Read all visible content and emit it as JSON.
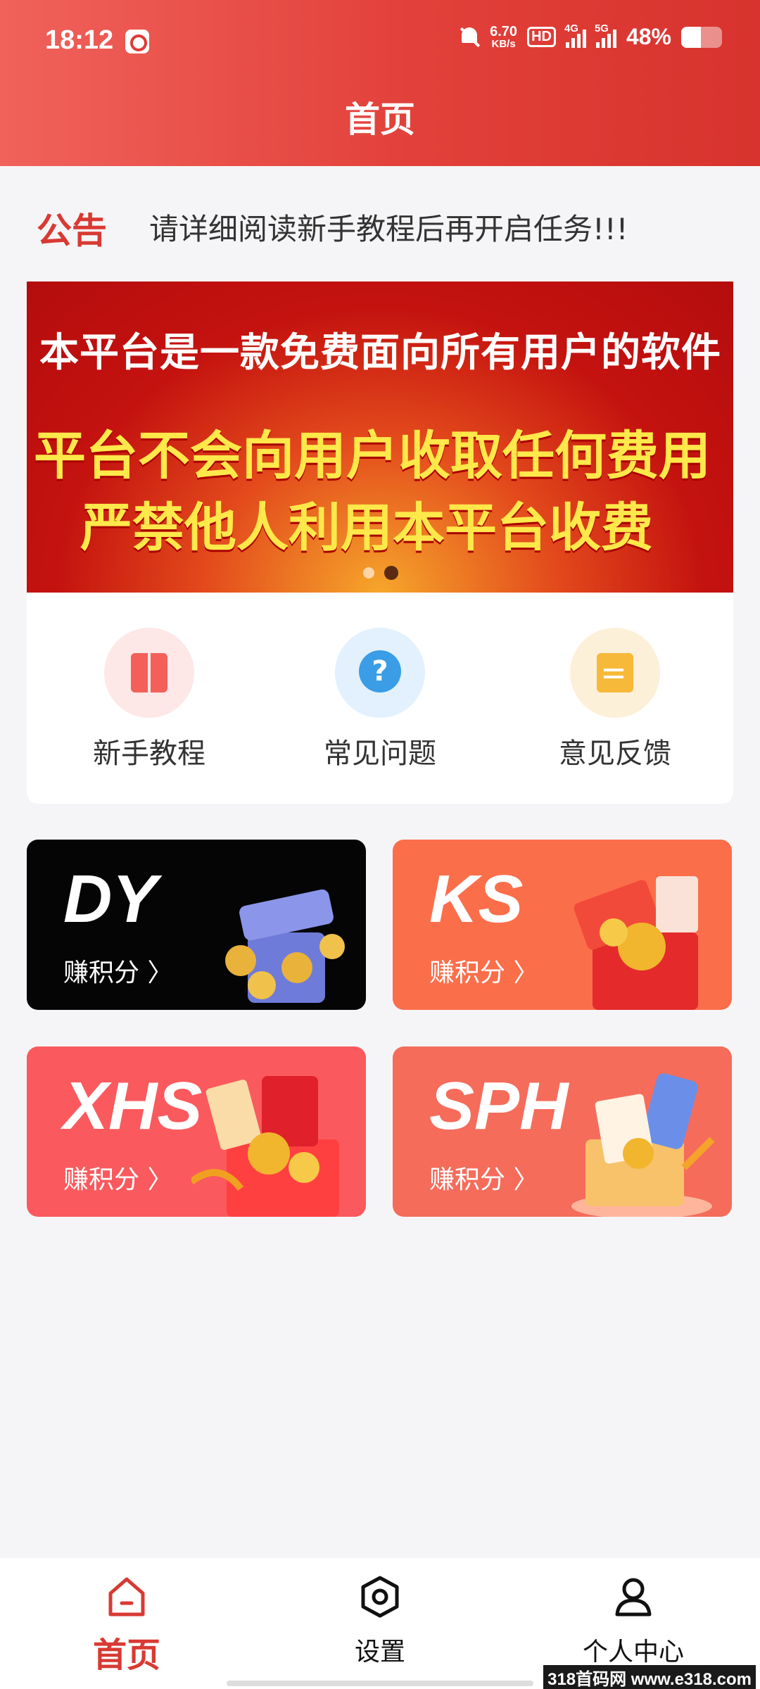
{
  "status_bar": {
    "time": "18:12",
    "net_speed_value": "6.70",
    "net_speed_unit": "KB/s",
    "hd_label": "HD",
    "sig1_label": "4G",
    "sig2_label": "5G",
    "battery_percent": "48%",
    "battery_level": 0.48
  },
  "header": {
    "title": "首页"
  },
  "notice": {
    "label": "公告",
    "text": "请详细阅读新手教程后再开启任务!!!"
  },
  "banner": {
    "line1": "本平台是一款免费面向所有用户的软件",
    "line2": "平台不会向用户收取任何费用",
    "line3": "严禁他人利用本平台收费",
    "slide_count": 2,
    "active_slide": 2
  },
  "quick_links": [
    {
      "label": "新手教程",
      "icon": "book-icon"
    },
    {
      "label": "常见问题",
      "icon": "question-icon"
    },
    {
      "label": "意见反馈",
      "icon": "feedback-icon"
    }
  ],
  "tasks": [
    {
      "title": "DY",
      "link": "赚积分 〉",
      "color": "#050505"
    },
    {
      "title": "KS",
      "link": "赚积分 〉",
      "color": "#fb6e4a"
    },
    {
      "title": "XHS",
      "link": "赚积分 〉",
      "color": "#fa5a5d"
    },
    {
      "title": "SPH",
      "link": "赚积分 〉",
      "color": "#f56c5b"
    }
  ],
  "tab_bar": [
    {
      "label": "首页",
      "icon": "home-icon",
      "active": true
    },
    {
      "label": "设置",
      "icon": "settings-icon",
      "active": false
    },
    {
      "label": "个人中心",
      "icon": "person-icon",
      "active": false
    }
  ],
  "watermark": "318首码网 www.e318.com",
  "colors": {
    "primary": "#d83a33",
    "header_gradient_start": "#f0625b",
    "header_gradient_end": "#d8332e"
  }
}
